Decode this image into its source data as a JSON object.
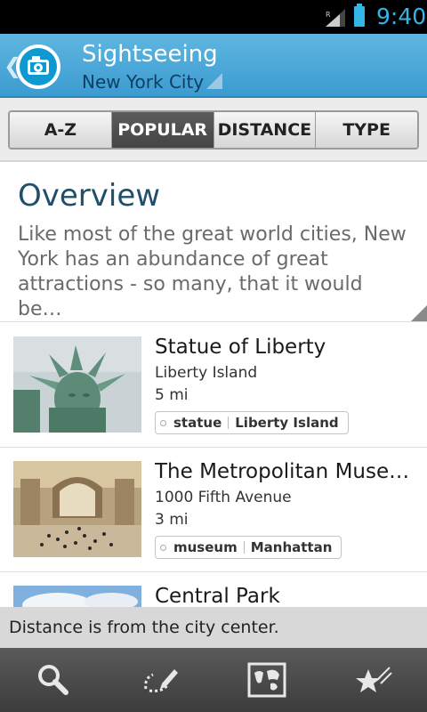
{
  "status_bar": {
    "time": "9:40",
    "icons": [
      "signal-icon",
      "battery-icon"
    ],
    "accent": "#33b5e5"
  },
  "header": {
    "title": "Sightseeing",
    "subtitle": "New York City",
    "icons": [
      "back-chevron-icon",
      "camera-icon",
      "dropdown-triangle-icon"
    ],
    "colors": {
      "bar": "#4aa8d8",
      "subtitle": "#0d3f66"
    }
  },
  "tabs": [
    {
      "label": "A-Z",
      "active": false
    },
    {
      "label": "POPULAR",
      "active": true
    },
    {
      "label": "DISTANCE",
      "active": false
    },
    {
      "label": "TYPE",
      "active": false
    }
  ],
  "overview": {
    "title": "Overview",
    "text": "Like most of the great world cities, New York has an abundance of great attractions - so many, that it would be…"
  },
  "items": [
    {
      "title": "Statue of Liberty",
      "address": "Liberty Island",
      "distance": "5 mi",
      "tags": [
        "statue",
        "Liberty Island"
      ]
    },
    {
      "title": "The Metropolitan Museu…",
      "address": "1000 Fifth Avenue",
      "distance": "3 mi",
      "tags": [
        "museum",
        "Manhattan"
      ]
    },
    {
      "title": "Central Park"
    }
  ],
  "toast": {
    "text": "Distance is from the city center."
  },
  "bottom_bar": {
    "icons": [
      "search-icon",
      "notes-icon",
      "map-icon",
      "favorites-icon"
    ]
  }
}
